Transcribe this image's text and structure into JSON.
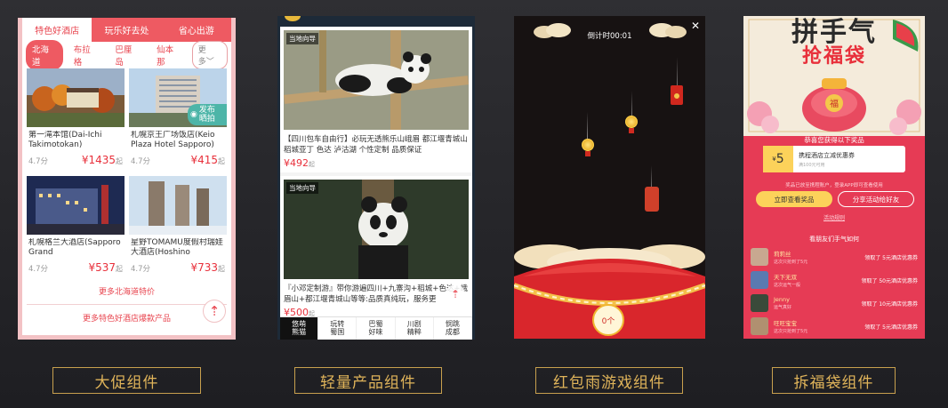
{
  "captions": [
    "大促组件",
    "轻量产品组件",
    "红包雨游戏组件",
    "拆福袋组件"
  ],
  "p1": {
    "tabs": [
      "特色好酒店",
      "玩乐好去处",
      "省心出游"
    ],
    "cities": [
      "北海道",
      "布拉格",
      "巴厘岛",
      "仙本那"
    ],
    "more": "更多",
    "hotels": [
      {
        "name": "第一滝本馆(Dai-Ichi Takimotokan)",
        "rating": "4.7分",
        "price": "¥1435",
        "unit": "起"
      },
      {
        "name": "札幌京王广场饭店(Keio Plaza Hotel Sapporo)",
        "rating": "4.7分",
        "price": "¥415",
        "unit": "起"
      },
      {
        "name": "札幌格兰大酒店(Sapporo Grand",
        "rating": "4.7分",
        "price": "¥537",
        "unit": "起"
      },
      {
        "name": "星野TOMAMU度假村瑞娃大酒店(Hoshino",
        "rating": "4.7分",
        "price": "¥733",
        "unit": "起"
      }
    ],
    "camera_label": "发布\n晒拍",
    "more_link": "更多北海道特价",
    "more_link2": "更多特色好酒店爆款产品"
  },
  "p2": {
    "items": [
      {
        "tag": "当地向导",
        "text": "【四川包车自由行】必玩无透熊乐山峨眉 都江堰青城山 稻城亚丁 色达 泸沽湖 个性定制 品质保证",
        "price": "¥492",
        "unit": "起"
      },
      {
        "tag": "当地向导",
        "text": "『小邓定制游』带你游遍四川+九寨沟+稻城+色达+峨眉山+都江堰青城山等等:品质真纯玩，服务更",
        "price": "¥500",
        "unit": "起"
      }
    ],
    "tabs": [
      "悠萌\n熊猫",
      "玩转\n蜀国",
      "巴蜀\n好味",
      "川剧\n精粹",
      "悯跳\n成都"
    ]
  },
  "p3": {
    "timer": "倒计时00:01",
    "count": "0个"
  },
  "p4": {
    "title": "拼手气",
    "subtitle": "抢福袋",
    "congrats": "恭喜您获得以下奖品",
    "coupon_amount": "5",
    "coupon_unit": "元",
    "coupon_name": "携程酒店立减优惠券",
    "coupon_sub": "满100元可用",
    "note": "奖品已放至携程账户，登录APP即可查看使用",
    "btn_view": "立即查看奖品",
    "btn_share": "分享活动给好友",
    "rules": "活动规则",
    "friends_title": "看朋友们手气如何",
    "friends": [
      {
        "name": "莉莉丝",
        "sub": "这次只抢到了5元",
        "prize": "领取了 5元酒店优惠券"
      },
      {
        "name": "天下无双",
        "sub": "这次运气一般",
        "prize": "领取了 50元酒店优惠券"
      },
      {
        "name": "Jenny",
        "sub": "运气真好",
        "prize": "领取了 10元酒店优惠券"
      },
      {
        "name": "旺旺宝宝",
        "sub": "这次只抢到了5元",
        "prize": "领取了 5元酒店优惠券"
      }
    ]
  }
}
